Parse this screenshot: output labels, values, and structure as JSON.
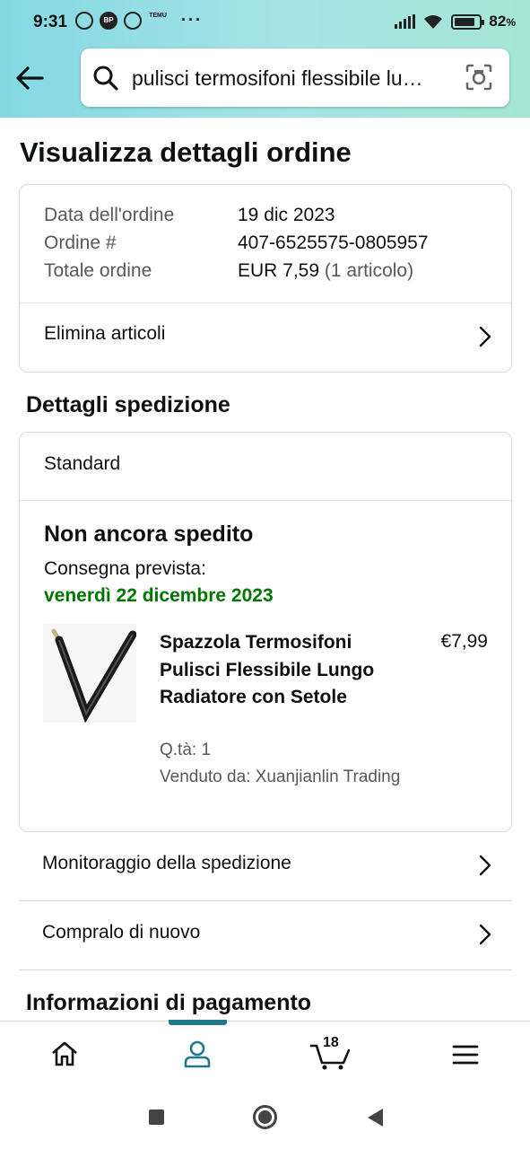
{
  "status_bar": {
    "time": "9:31",
    "battery_percent": "82",
    "battery_unit": "%",
    "battery_level": 0.82,
    "icons": [
      "alarm-icon",
      "bp-icon",
      "app-icon",
      "temu-icon"
    ],
    "app_icon_text": "BP",
    "temu_icon_text": "TEMU",
    "overflow": "···"
  },
  "header": {
    "search_query": "pulisci termosifoni flessibile lu…"
  },
  "page": {
    "title": "Visualizza dettagli ordine"
  },
  "order_summary": {
    "date_label": "Data dell'ordine",
    "date_value": "19 dic 2023",
    "order_label": "Ordine #",
    "order_value": "407-6525575-0805957",
    "total_label": "Totale ordine",
    "total_value": "EUR 7,59",
    "total_items": "(1 articolo)",
    "delete_items_label": "Elimina articoli"
  },
  "shipping": {
    "section_title": "Dettagli spedizione",
    "method": "Standard",
    "status": "Non ancora spedito",
    "delivery_label": "Consegna prevista:",
    "delivery_date": "venerdì 22 dicembre 2023",
    "item": {
      "name": "Spazzola Termosifoni Pulisci Flessibile Lungo Radiatore con Setole",
      "price": "€7,99",
      "qty": "Q.tà: 1",
      "seller": "Venduto da: Xuanjianlin Trading"
    }
  },
  "actions": {
    "track_label": "Monitoraggio della spedizione",
    "buy_again_label": "Compralo di nuovo"
  },
  "payment": {
    "section_title": "Informazioni di pagamento"
  },
  "bottom_nav": {
    "cart_count": "18",
    "active_tab": "account",
    "accent": "#1f7a8c"
  },
  "colors": {
    "delivery_green": "#007600",
    "header_gradient_start": "#84d8e3",
    "header_gradient_end": "#a5e6d2"
  }
}
